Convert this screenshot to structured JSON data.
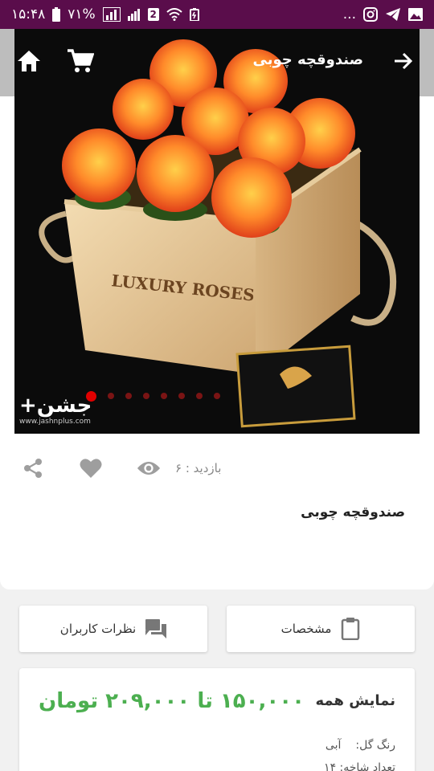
{
  "status_bar": {
    "time": "۱۵:۴۸",
    "battery": "۷۱%",
    "sim_badge": "2",
    "overflow": "..."
  },
  "toolbar": {
    "title": "صندوقچه چوبی"
  },
  "hero": {
    "box_text": "LUXURY ROSES",
    "brand": "جشن+",
    "brand_url": "www.jashnplus.com",
    "dot_count": 8,
    "active_dot": 0
  },
  "stats": {
    "views_label": "بازدید : ۶"
  },
  "product": {
    "title": "صندوقچه چوبی"
  },
  "tabs": {
    "specs": "مشخصات",
    "reviews": "نظرات کاربران"
  },
  "pricing": {
    "show_all": "نمایش همه",
    "range": "۱۵۰,۰۰۰ تا ۲۰۹,۰۰۰ تومان",
    "flower_color_label": "رنگ گل:",
    "flower_color_value": "آبی",
    "partial_row": "تعداد شاخه: ۱۴"
  },
  "colors": {
    "status_bar": "#5a0d4b",
    "price_green": "#4caf50",
    "dot_active": "#e00000"
  }
}
